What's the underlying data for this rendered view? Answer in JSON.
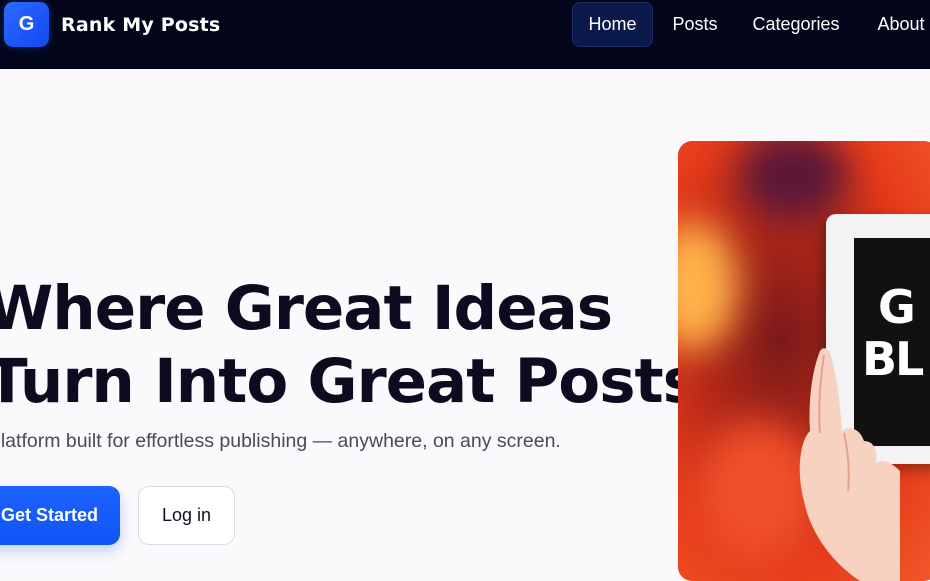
{
  "brand": {
    "logo_letter": "G",
    "name": "Rank My Posts"
  },
  "nav": {
    "items": [
      {
        "label": "Home",
        "active": true
      },
      {
        "label": "Posts",
        "active": false
      },
      {
        "label": "Categories",
        "active": false
      },
      {
        "label": "About",
        "active": false
      }
    ]
  },
  "hero": {
    "title_line1": "Where Great Ideas",
    "title_line2": "Turn Into Great Posts",
    "subtitle": "platform built for effortless publishing — anywhere, on any screen.",
    "primary_cta": "Get Started",
    "secondary_cta": "Log in"
  },
  "hero_image": {
    "sign_line1": "G",
    "sign_line2": "BL"
  },
  "colors": {
    "nav_bg": "#03061a",
    "accent": "#1655f5",
    "page_bg": "#fbf9fc",
    "heading": "#0c0b1f"
  }
}
